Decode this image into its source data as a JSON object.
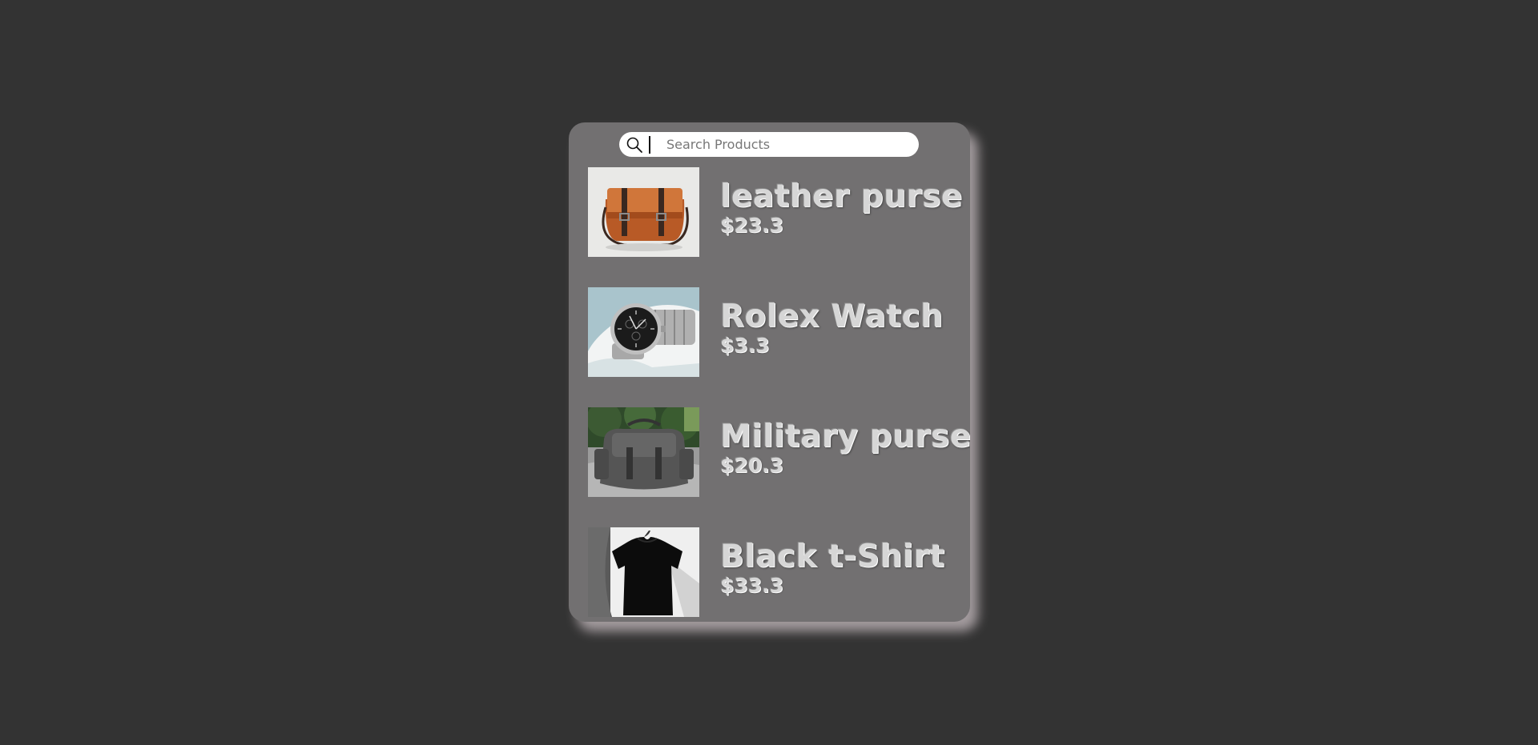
{
  "search": {
    "placeholder": "Search Products",
    "value": ""
  },
  "products": [
    {
      "name": "leather purse",
      "price": "$23.3",
      "image": "leather-purse-photo"
    },
    {
      "name": "Rolex Watch",
      "price": "$3.3",
      "image": "rolex-watch-photo"
    },
    {
      "name": "Military purse",
      "price": "$20.3",
      "image": "military-purse-photo"
    },
    {
      "name": "Black t-Shirt",
      "price": "$33.3",
      "image": "black-tshirt-photo"
    }
  ],
  "colors": {
    "page_background": "#333333",
    "panel_background": "#727071",
    "text": "#d6d6d6"
  }
}
